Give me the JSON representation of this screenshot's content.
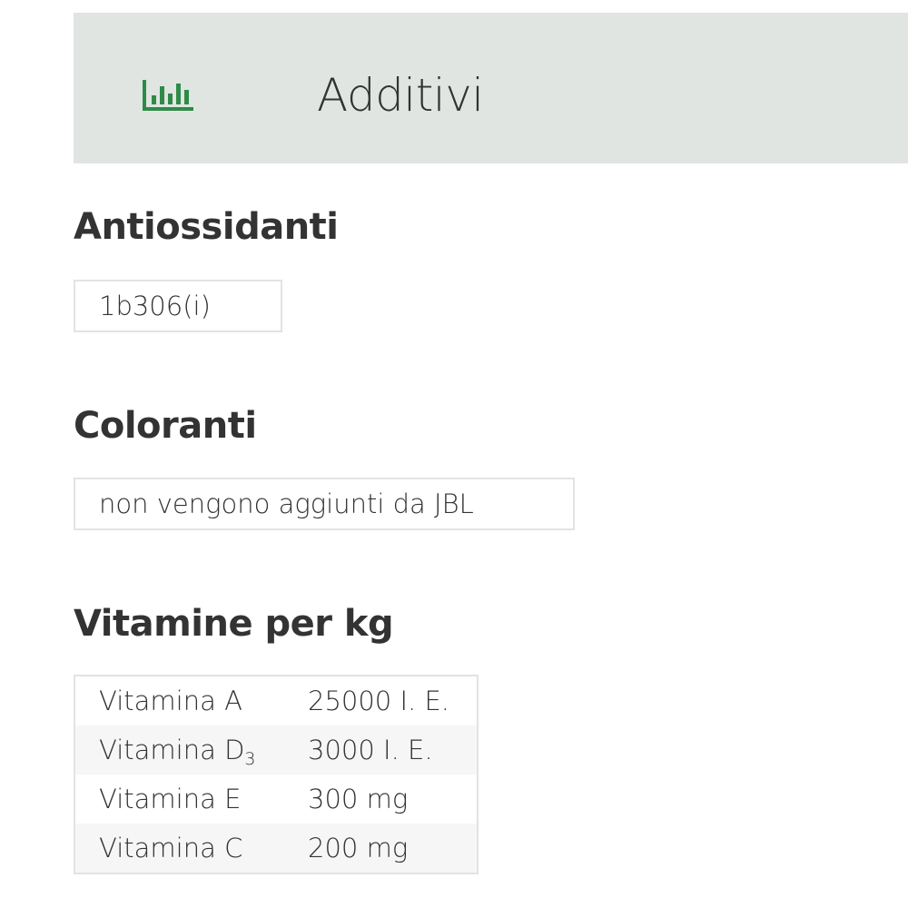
{
  "header": {
    "icon": "bar-chart-icon",
    "title": "Additivi",
    "icon_color": "#2e8b47",
    "background": "#e0e5e1"
  },
  "antioxidants": {
    "heading": "Antiossidanti",
    "value": "1b306(i)"
  },
  "colorants": {
    "heading": "Coloranti",
    "value": "non vengono aggiunti da JBL"
  },
  "vitamins": {
    "heading": "Vitamine per kg",
    "rows": [
      {
        "name": "Vitamina A",
        "name_sub": "",
        "amount": "25000 I. E."
      },
      {
        "name": "Vitamina D",
        "name_sub": "3",
        "amount": "3000 I. E."
      },
      {
        "name": "Vitamina E",
        "name_sub": "",
        "amount": "300 mg"
      },
      {
        "name": "Vitamina C",
        "name_sub": "",
        "amount": "200 mg"
      }
    ]
  }
}
